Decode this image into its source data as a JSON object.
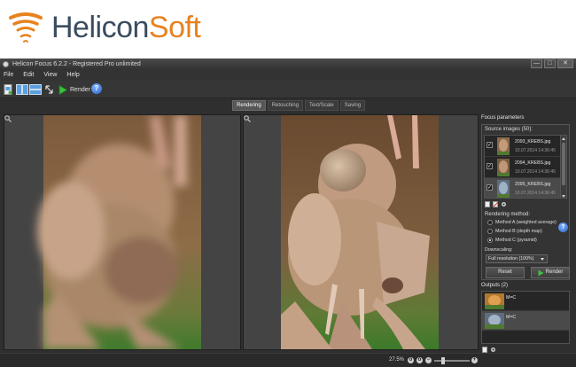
{
  "brand": {
    "name_part1": "Helicon",
    "name_part2": "Soft",
    "color_dark": "#3a4c61",
    "color_accent": "#e7821f"
  },
  "window": {
    "title": "Helicon Focus 6.2.2 - Registered Pro unlimited",
    "buttons": [
      "—",
      "□",
      "✕"
    ]
  },
  "menu": [
    "File",
    "Edit",
    "View",
    "Help"
  ],
  "toolbar": {
    "render_label": "Render",
    "help_label": "?"
  },
  "tabs": [
    {
      "label": "Rendering",
      "active": true
    },
    {
      "label": "Retouching",
      "active": false
    },
    {
      "label": "Text/Scale",
      "active": false
    },
    {
      "label": "Saving",
      "active": false
    }
  ],
  "panel": {
    "title": "Focus parameters",
    "source_label": "Source images (50):",
    "sources": [
      {
        "name": "2093_KREBS.jpg",
        "date": "10.07.2014 14:36:45",
        "checked": true
      },
      {
        "name": "2094_KREBS.jpg",
        "date": "10.07.2014 14:36:45",
        "checked": true
      },
      {
        "name": "2095_KREBS.jpg",
        "date": "10.07.2014 14:36:45",
        "checked": true
      }
    ],
    "method_label": "Rendering method:",
    "methods": [
      {
        "label": "Method A (weighted average)",
        "selected": false
      },
      {
        "label": "Method B (depth map)",
        "selected": false
      },
      {
        "label": "Method C (pyramid)",
        "selected": true
      }
    ],
    "downscaling_label": "Downscaling:",
    "downscaling_value": "Full resolution (100%)",
    "reset_label": "Reset",
    "render_label": "Render",
    "outputs_label": "Outputs (2)",
    "outputs": [
      {
        "name": "M=C"
      },
      {
        "name": "M=C"
      }
    ]
  },
  "status": {
    "zoom": "27.5%"
  },
  "icons": {
    "logo": "helicon-spiral-icon",
    "play": "play-icon",
    "help": "help-icon"
  }
}
